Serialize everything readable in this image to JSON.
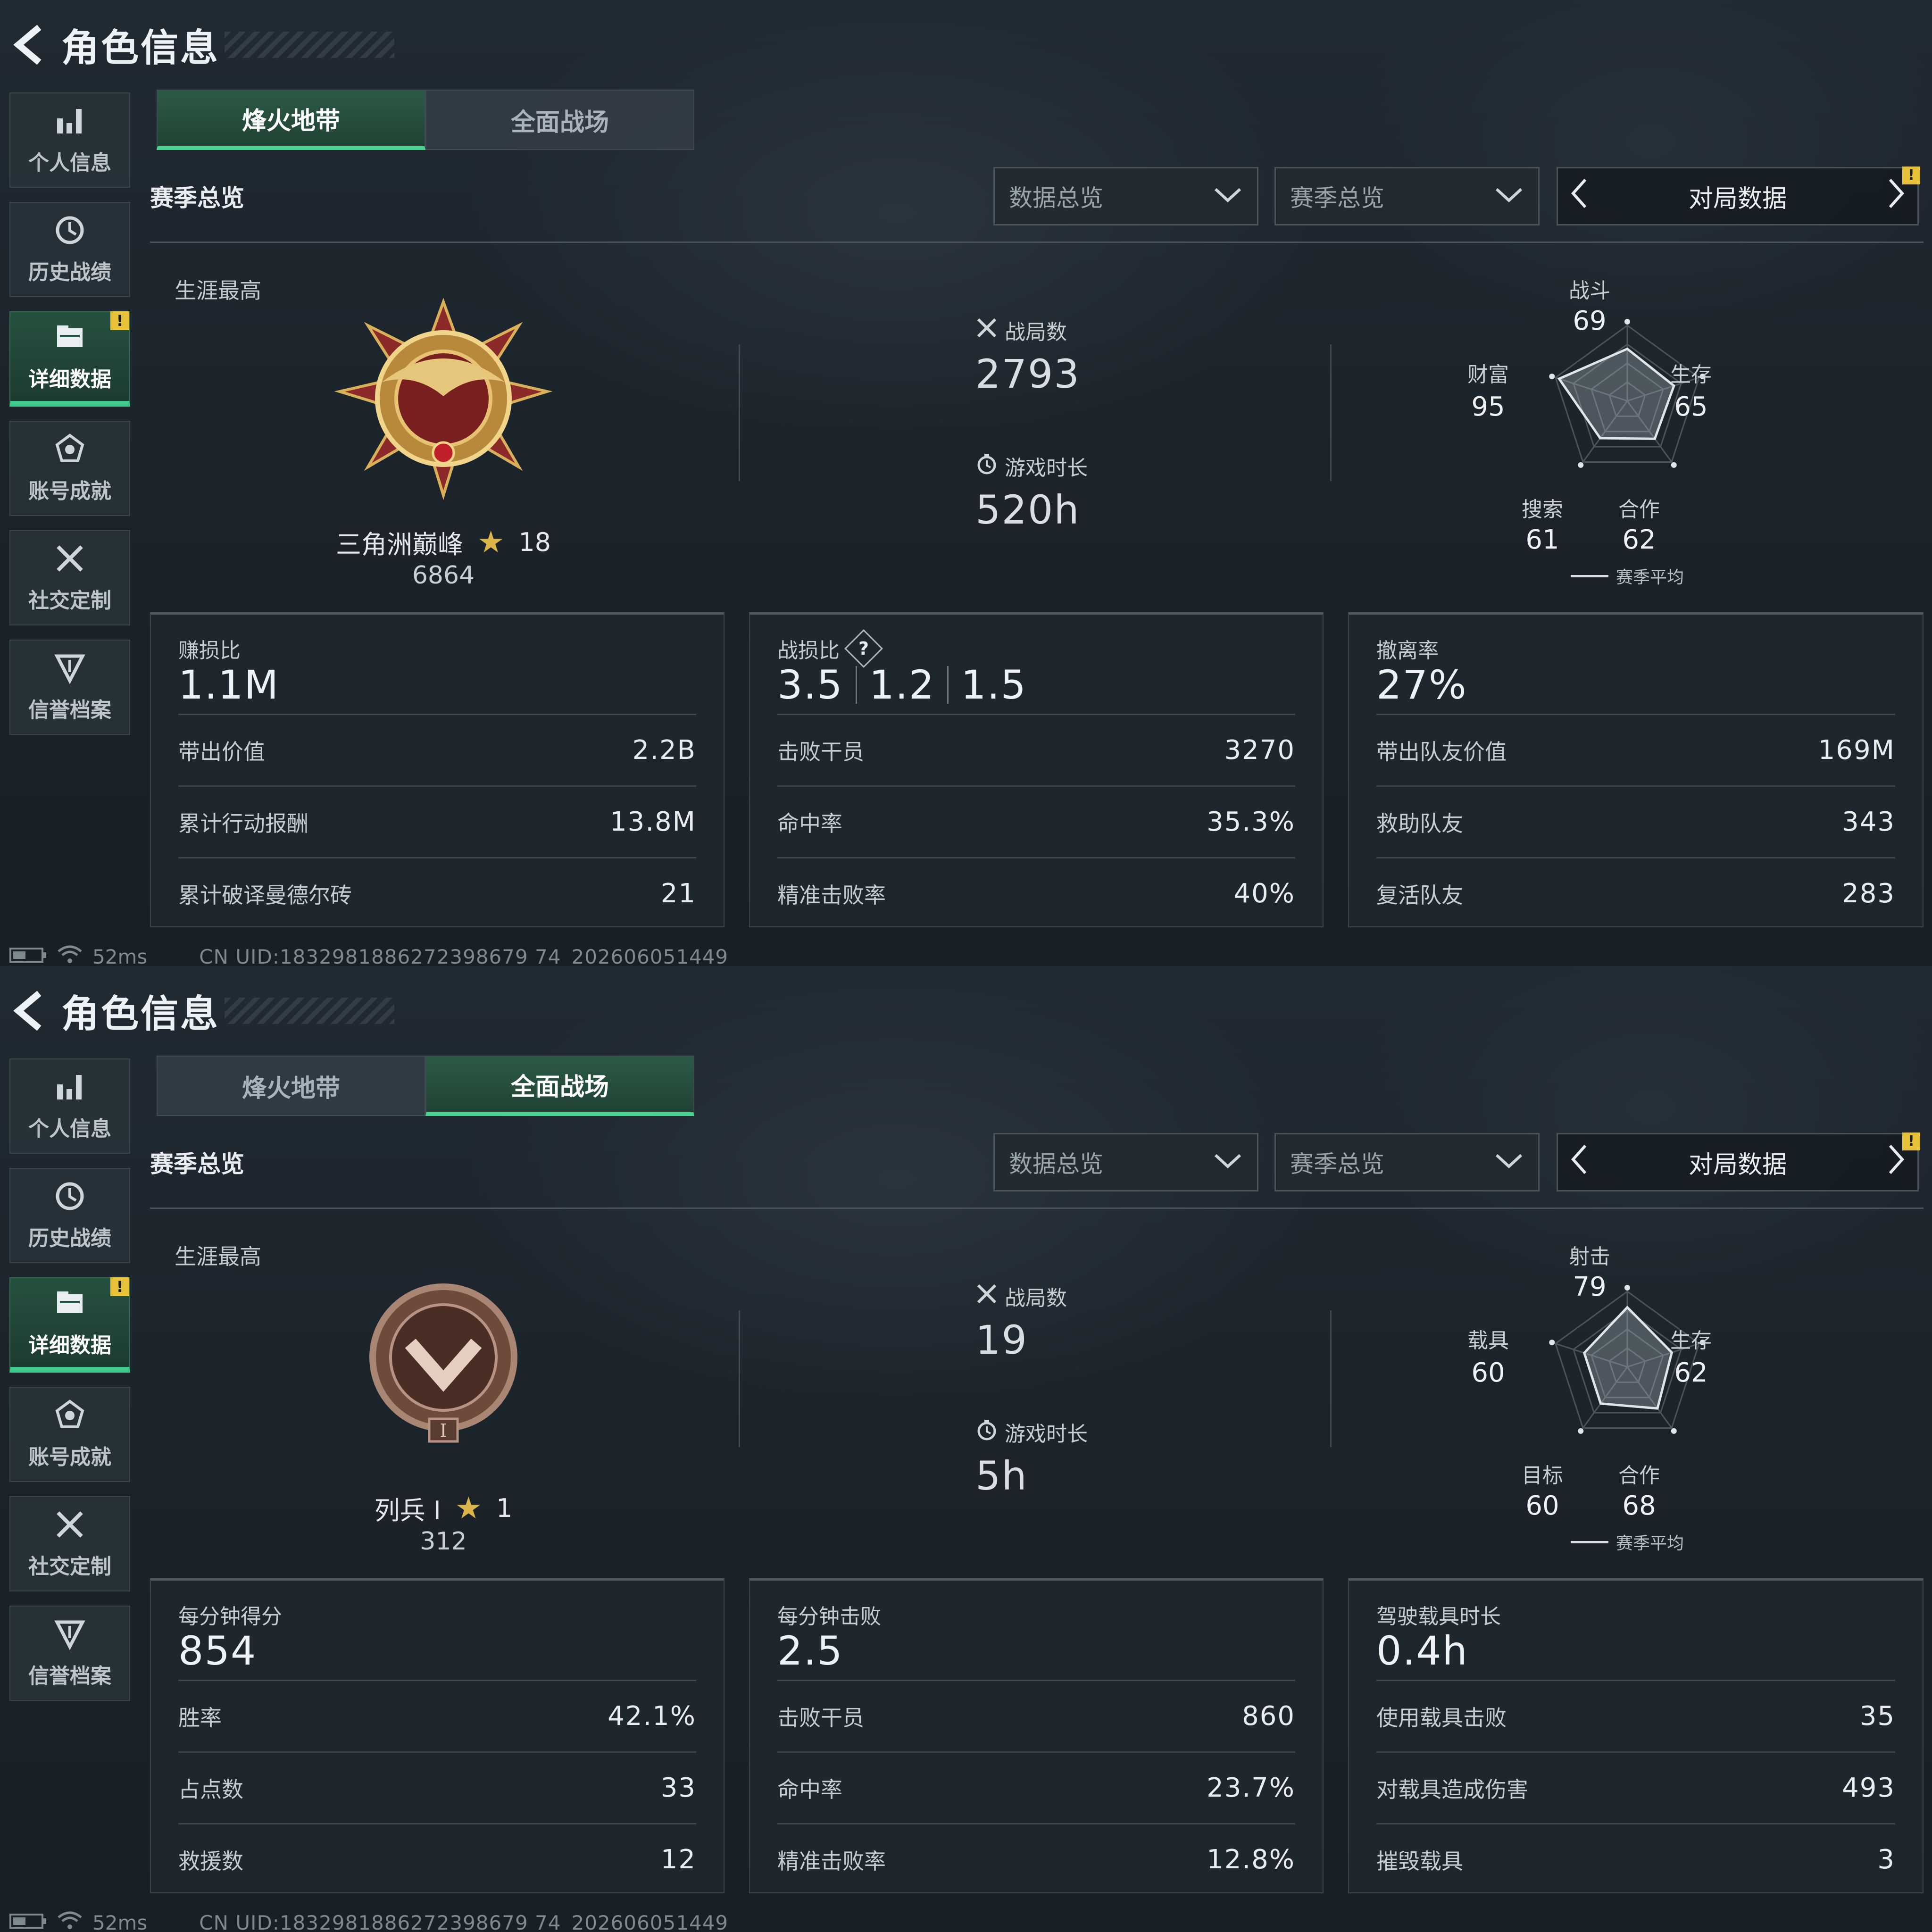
{
  "panels": [
    {
      "title": "角色信息",
      "sidebar": [
        "个人信息",
        "历史战绩",
        "详细数据",
        "账号成就",
        "社交定制",
        "信誉档案"
      ],
      "sidebar_badge": "!",
      "tabs": [
        "烽火地带",
        "全面战场"
      ],
      "active_tab": 0,
      "section": "赛季总览",
      "dropdown1": "数据总览",
      "dropdown2": "赛季总览",
      "nav_label": "对局数据",
      "nav_badge": "!",
      "career_label": "生涯最高",
      "rank_name": "三角洲巅峰",
      "rank_stars": "18",
      "rank_score": "6864",
      "stat1_label": "战局数",
      "stat1_value": "2793",
      "stat2_label": "游戏时长",
      "stat2_value": "520h",
      "radar": {
        "labels": [
          "战斗",
          "生存",
          "合作",
          "搜索",
          "财富"
        ],
        "values": [
          "69",
          "65",
          "62",
          "61",
          "95"
        ],
        "levels": [
          69,
          65,
          62,
          61,
          95
        ]
      },
      "legend": "赛季平均",
      "cards": [
        {
          "head": "赚损比",
          "big": [
            "1.1M"
          ],
          "rows": [
            [
              "带出价值",
              "2.2B"
            ],
            [
              "累计行动报酬",
              "13.8M"
            ],
            [
              "累计破译曼德尔砖",
              "21"
            ]
          ]
        },
        {
          "head": "战损比",
          "help": "?",
          "big": [
            "3.5",
            "1.2",
            "1.5"
          ],
          "rows": [
            [
              "击败干员",
              "3270"
            ],
            [
              "命中率",
              "35.3%"
            ],
            [
              "精准击败率",
              "40%"
            ]
          ]
        },
        {
          "head": "撤离率",
          "big": [
            "27%"
          ],
          "rows": [
            [
              "带出队友价值",
              "169M"
            ],
            [
              "救助队友",
              "343"
            ],
            [
              "复活队友",
              "283"
            ]
          ]
        }
      ],
      "ping": "52ms",
      "uid": "CN UID:1832981886272398679 74_202606051449"
    },
    {
      "title": "角色信息",
      "sidebar": [
        "个人信息",
        "历史战绩",
        "详细数据",
        "账号成就",
        "社交定制",
        "信誉档案"
      ],
      "sidebar_badge": "!",
      "tabs": [
        "烽火地带",
        "全面战场"
      ],
      "active_tab": 1,
      "section": "赛季总览",
      "dropdown1": "数据总览",
      "dropdown2": "赛季总览",
      "nav_label": "对局数据",
      "nav_badge": "!",
      "career_label": "生涯最高",
      "rank_name": "列兵 I",
      "rank_stars": "1",
      "rank_score": "312",
      "rank_roman": "I",
      "stat1_label": "战局数",
      "stat1_value": "19",
      "stat2_label": "游戏时长",
      "stat2_value": "5h",
      "radar": {
        "labels": [
          "射击",
          "生存",
          "合作",
          "目标",
          "载具"
        ],
        "values": [
          "79",
          "62",
          "68",
          "60",
          "60"
        ],
        "levels": [
          79,
          62,
          68,
          60,
          60
        ]
      },
      "legend": "赛季平均",
      "cards": [
        {
          "head": "每分钟得分",
          "big": [
            "854"
          ],
          "rows": [
            [
              "胜率",
              "42.1%"
            ],
            [
              "占点数",
              "33"
            ],
            [
              "救援数",
              "12"
            ]
          ]
        },
        {
          "head": "每分钟击败",
          "big": [
            "2.5"
          ],
          "rows": [
            [
              "击败干员",
              "860"
            ],
            [
              "命中率",
              "23.7%"
            ],
            [
              "精准击败率",
              "12.8%"
            ]
          ]
        },
        {
          "head": "驾驶载具时长",
          "big": [
            "0.4h"
          ],
          "rows": [
            [
              "使用载具击败",
              "35"
            ],
            [
              "对载具造成伤害",
              "493"
            ],
            [
              "摧毁载具",
              "3"
            ]
          ]
        }
      ],
      "ping": "52ms",
      "uid": "CN UID:1832981886272398679 74_202606051449"
    }
  ]
}
